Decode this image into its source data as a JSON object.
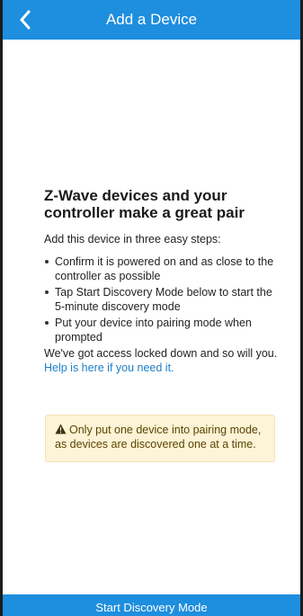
{
  "header": {
    "title": "Add a Device",
    "back_icon": "chevron-left-icon"
  },
  "main": {
    "headline": "Z-Wave devices and your controller make a great pair",
    "intro": "Add this device in three easy steps:",
    "steps": [
      "Confirm it is powered on and as close to the controller as possible",
      "Tap Start Discovery Mode below to start the 5-minute discovery mode",
      "Put your device into pairing mode when prompted"
    ],
    "access_text": "We've got access locked down and so will you. ",
    "help_link": "Help is here if you need it."
  },
  "notice": {
    "icon": "warning-icon",
    "text": "Only put one device into pairing mode, as devices are discovered one at a time."
  },
  "footer": {
    "button_label": "Start Discovery Mode"
  },
  "colors": {
    "accent": "#1e8ede",
    "link": "#1e7fc8",
    "notice_bg": "#fdf3d6"
  }
}
